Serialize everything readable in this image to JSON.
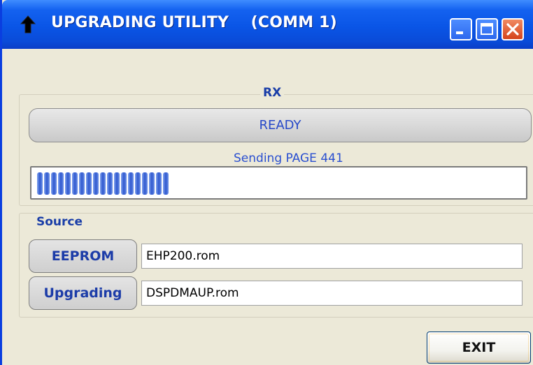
{
  "window": {
    "title": "UPGRADING UTILITY    (COMM 1)",
    "app_icon": "arrow-up-icon",
    "controls": [
      "minimize-icon",
      "maximize-icon",
      "close-icon"
    ]
  },
  "menu": {
    "help_label": "?"
  },
  "rx_group": {
    "legend": "RX",
    "status_text": "READY",
    "progress_legend": "Sending PAGE  441",
    "progress_fraction": 0.28
  },
  "source_group": {
    "legend": "Source",
    "eeprom_button": "EEPROM",
    "eeprom_file": "EHP200.rom",
    "upgrading_button": "Upgrading",
    "upgrading_file": "DSPDMAUP.rom"
  },
  "footer": {
    "exit_button": "EXIT"
  },
  "colors": {
    "title_bar": "#0a55e6",
    "label_blue": "#1a3ea8",
    "progress_block": "#3a64d8",
    "close_button": "#d5431b"
  }
}
